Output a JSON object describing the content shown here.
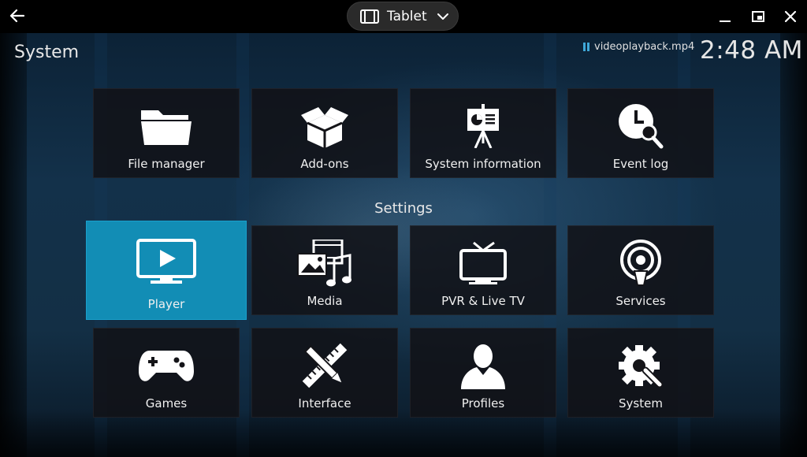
{
  "window": {
    "mode_label": "Tablet"
  },
  "header": {
    "title": "System",
    "now_playing": "videoplayback.mp4",
    "clock": "2:48 AM"
  },
  "top_row": [
    {
      "label": "File manager",
      "icon": "folder-icon"
    },
    {
      "label": "Add-ons",
      "icon": "open-box-icon"
    },
    {
      "label": "System information",
      "icon": "presentation-icon"
    },
    {
      "label": "Event log",
      "icon": "clock-search-icon"
    }
  ],
  "settings": {
    "heading": "Settings",
    "items": [
      {
        "label": "Player",
        "icon": "tv-play-icon",
        "selected": true
      },
      {
        "label": "Media",
        "icon": "media-icon"
      },
      {
        "label": "PVR & Live TV",
        "icon": "tv-antenna-icon"
      },
      {
        "label": "Services",
        "icon": "broadcast-icon"
      },
      {
        "label": "Games",
        "icon": "gamepad-icon"
      },
      {
        "label": "Interface",
        "icon": "pencil-ruler-icon"
      },
      {
        "label": "Profiles",
        "icon": "user-icon"
      },
      {
        "label": "System",
        "icon": "gear-wrench-icon"
      }
    ]
  },
  "colors": {
    "accent": "#128db5",
    "tile_bg": "#141418",
    "chrome_bg": "#000000"
  }
}
